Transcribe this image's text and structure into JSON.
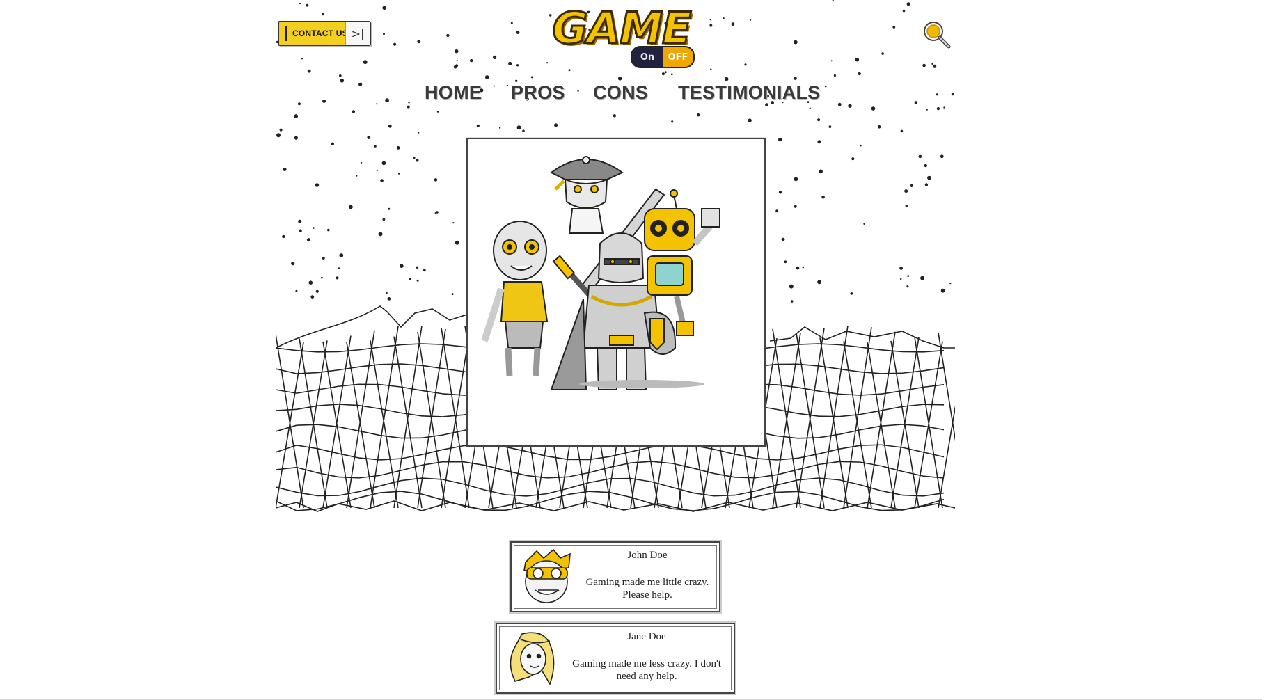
{
  "header": {
    "contact_label": "CONTACT US",
    "contact_arrow": ">|",
    "logo": {
      "word": "GAME",
      "toggle_on": "On",
      "toggle_off": "OFF"
    },
    "search_icon": "search-icon"
  },
  "nav": {
    "items": [
      {
        "label": "HOME"
      },
      {
        "label": "PROS"
      },
      {
        "label": "CONS"
      },
      {
        "label": "TESTIMONIALS"
      }
    ]
  },
  "hero": {
    "image_subject": "group of cartoon game characters: pirate, zombie, knight with sword, robot"
  },
  "testimonials": [
    {
      "name": "John Doe",
      "quote": "Gaming made me little crazy. Please help."
    },
    {
      "name": "Jane Doe",
      "quote": "Gaming made me less crazy. I don't need any help."
    }
  ],
  "colors": {
    "accent_yellow": "#f3cf1f",
    "logo_gold": "#f2c300",
    "toggle_orange": "#f0a800",
    "ink": "#222222",
    "nav_text": "#3a3a3a"
  }
}
